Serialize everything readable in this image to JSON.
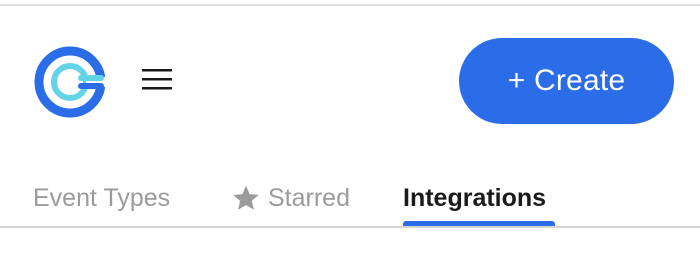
{
  "header": {
    "create_label": "+ Create"
  },
  "tabs": [
    {
      "label": "Event Types",
      "icon": "",
      "active": false
    },
    {
      "label": "Starred",
      "icon": "star-icon",
      "active": false
    },
    {
      "label": "Integrations",
      "icon": "",
      "active": true
    }
  ],
  "colors": {
    "accent": "#2b6de8",
    "logo_inner": "#62d4e8",
    "tab_inactive": "#9b9b9b",
    "tab_active": "#1a1a1a"
  }
}
